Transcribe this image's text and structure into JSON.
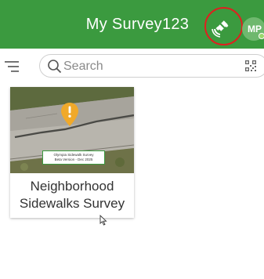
{
  "header": {
    "title": "My Survey123",
    "avatar_initials": "MP",
    "gps_icon": "satellite-gps-icon",
    "background": "#3b9a3f"
  },
  "toolbar": {
    "menu_icon": "filter-menu-icon",
    "search": {
      "placeholder": "Search",
      "value": ""
    },
    "qr_icon": "qr-code-icon"
  },
  "surveys": [
    {
      "thumbnail_text_line1": "Olympia Sidewalk Survey",
      "thumbnail_text_line2": "Beta Version - Dec 2025",
      "title_line1": "Neighborhood",
      "title_line2": "Sidewalks Survey"
    }
  ],
  "colors": {
    "brand_green": "#3b9a3f",
    "highlight_red": "#e01f1f",
    "marker_orange": "#f0a92a"
  }
}
